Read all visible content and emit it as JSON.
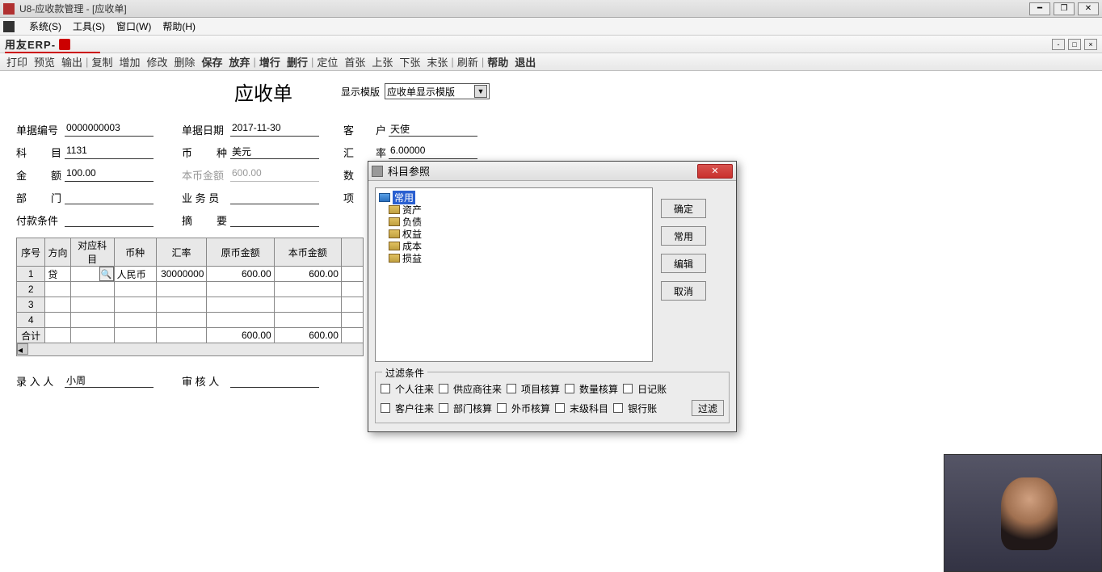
{
  "window": {
    "title": "U8-应收款管理 - [应收单]"
  },
  "outerMenu": {
    "system": "系统(S)",
    "tools": "工具(S)",
    "window": "窗口(W)",
    "help": "帮助(H)"
  },
  "brand": {
    "text": "用友ERP-"
  },
  "toolbar": {
    "print": "打印",
    "preview": "预览",
    "output": "输出",
    "copy": "复制",
    "add": "增加",
    "modify": "修改",
    "delete": "删除",
    "save": "保存",
    "discard": "放弃",
    "addRow": "增行",
    "delRow": "删行",
    "locate": "定位",
    "first": "首张",
    "prev": "上张",
    "next": "下张",
    "last": "末张",
    "refresh": "刷新",
    "helpBtn": "帮助",
    "exit": "退出"
  },
  "doc": {
    "title": "应收单",
    "templateLabel": "显示模版",
    "templateValue": "应收单显示模版"
  },
  "form": {
    "billNo": {
      "label": "单据编号",
      "value": "0000000003"
    },
    "billDate": {
      "label": "单据日期",
      "value": "2017-11-30"
    },
    "customer": {
      "label1": "客",
      "label2": "户",
      "value": "天使"
    },
    "subject": {
      "label1": "科",
      "label2": "目",
      "value": "1131"
    },
    "currency": {
      "label1": "币",
      "label2": "种",
      "value": "美元"
    },
    "rate": {
      "label1": "汇",
      "label2": "率",
      "value": "6.00000"
    },
    "amount": {
      "label1": "金",
      "label2": "额",
      "value": "100.00"
    },
    "localAmount": {
      "label": "本币金额",
      "value": "600.00"
    },
    "qty": {
      "label": "数"
    },
    "dept": {
      "label1": "部",
      "label2": "门",
      "value": ""
    },
    "clerk": {
      "label": "业 务 员",
      "value": ""
    },
    "item": {
      "label": "项"
    },
    "payTerms": {
      "label": "付款条件",
      "value": ""
    },
    "summary": {
      "label1": "摘",
      "label2": "要",
      "value": ""
    },
    "entryBy": {
      "label": "录 入 人",
      "value": "小周"
    },
    "auditBy": {
      "label": "审 核 人",
      "value": ""
    }
  },
  "grid": {
    "headers": {
      "seq": "序号",
      "dir": "方向",
      "acct": "对应科目",
      "curr": "币种",
      "rate": "汇率",
      "origAmt": "原币金额",
      "localAmt": "本币金额"
    },
    "rows": [
      {
        "seq": "1",
        "dir": "贷",
        "acct": "",
        "curr": "人民币",
        "rate": "30000000",
        "origAmt": "600.00",
        "localAmt": "600.00"
      },
      {
        "seq": "2"
      },
      {
        "seq": "3"
      },
      {
        "seq": "4"
      }
    ],
    "totalLabel": "合计",
    "totalOrig": "600.00",
    "totalLocal": "600.00"
  },
  "modal": {
    "title": "科目参照",
    "tree": {
      "root": "常用",
      "items": [
        "资产",
        "负债",
        "权益",
        "成本",
        "损益"
      ]
    },
    "buttons": {
      "ok": "确定",
      "common": "常用",
      "edit": "编辑",
      "cancel": "取消"
    },
    "filter": {
      "legend": "过滤条件",
      "r1": [
        "个人往来",
        "供应商往来",
        "项目核算",
        "数量核算",
        "日记账"
      ],
      "r2": [
        "客户往来",
        "部门核算",
        "外币核算",
        "末级科目",
        "银行账"
      ],
      "btn": "过滤"
    }
  }
}
